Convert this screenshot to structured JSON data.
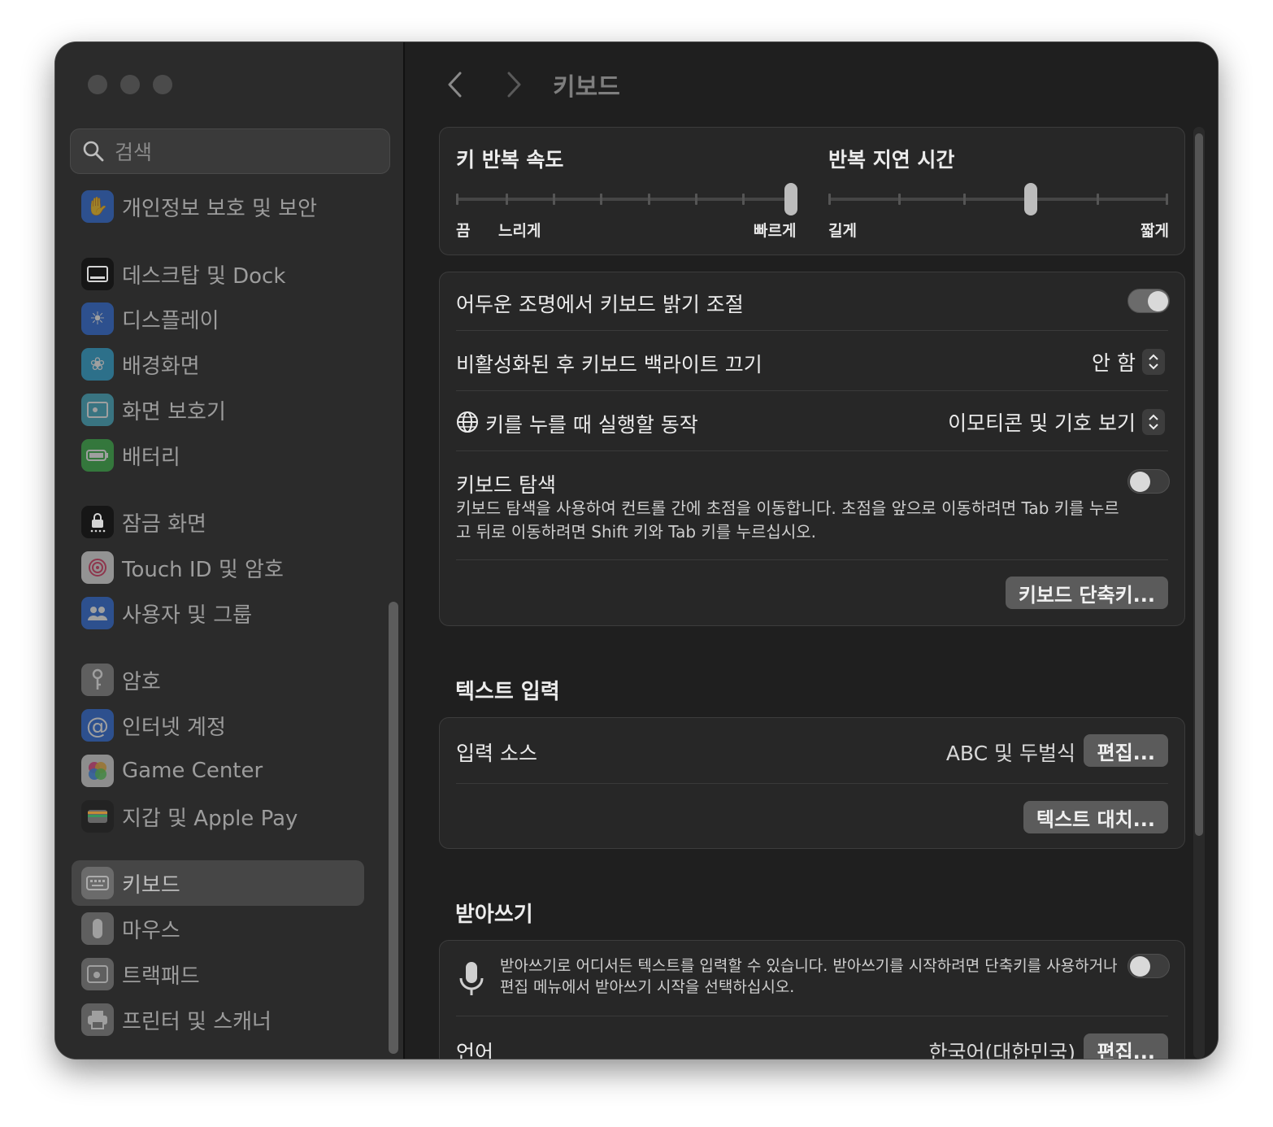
{
  "sidebar": {
    "search_placeholder": "검색",
    "items": [
      {
        "label": "개인정보 보호 및 보안",
        "icon": "hand-icon",
        "color": "#2f6fe0"
      },
      {
        "label": "데스크탑 및 Dock",
        "icon": "dock-icon",
        "color": "#111111"
      },
      {
        "label": "디스플레이",
        "icon": "sun-icon",
        "color": "#2f6fe0"
      },
      {
        "label": "배경화면",
        "icon": "flower-icon",
        "color": "#2fa9d8"
      },
      {
        "label": "화면 보호기",
        "icon": "screensaver-icon",
        "color": "#45b0c8"
      },
      {
        "label": "배터리",
        "icon": "battery-icon",
        "color": "#3cb64a"
      },
      {
        "label": "잠금 화면",
        "icon": "lock-icon",
        "color": "#111111"
      },
      {
        "label": "Touch ID 및 암호",
        "icon": "fingerprint-icon",
        "color": "#e9e9e9"
      },
      {
        "label": "사용자 및 그룹",
        "icon": "users-icon",
        "color": "#2f6fe0"
      },
      {
        "label": "암호",
        "icon": "key-icon",
        "color": "#8a8a8a"
      },
      {
        "label": "인터넷 계정",
        "icon": "at-icon",
        "color": "#2f6fe0"
      },
      {
        "label": "Game Center",
        "icon": "gamecenter-icon",
        "color": "#dddddd"
      },
      {
        "label": "지갑 및 Apple Pay",
        "icon": "wallet-icon",
        "color": "#222222"
      },
      {
        "label": "키보드",
        "icon": "keyboard-icon",
        "color": "#8a8a8a"
      },
      {
        "label": "마우스",
        "icon": "mouse-icon",
        "color": "#8a8a8a"
      },
      {
        "label": "트랙패드",
        "icon": "trackpad-icon",
        "color": "#8a8a8a"
      },
      {
        "label": "프린터 및 스캐너",
        "icon": "printer-icon",
        "color": "#8a8a8a"
      }
    ]
  },
  "header": {
    "title": "키보드"
  },
  "repeat": {
    "key_repeat_title": "키 반복 속도",
    "key_repeat_labels": [
      "끔",
      "느리게",
      "빠르게"
    ],
    "key_repeat_value": 1.0,
    "delay_title": "반복 지연 시간",
    "delay_labels": [
      "길게",
      "짧게"
    ],
    "delay_value": 0.6
  },
  "options": {
    "adjust_brightness": "어두운 조명에서 키보드 밝기 조절",
    "adjust_brightness_on": true,
    "backlight_off": "비활성화된 후 키보드 백라이트 끄기",
    "backlight_off_value": "안 함",
    "globe_key": "키를 누를 때 실행할 동작",
    "globe_key_value": "이모티콘 및 기호 보기",
    "keyboard_nav": "키보드 탐색",
    "keyboard_nav_desc": "키보드 탐색을 사용하여 컨트롤 간에 초점을 이동합니다. 초점을 앞으로 이동하려면 Tab 키를 누르고 뒤로 이동하려면 Shift 키와 Tab 키를 누르십시오.",
    "keyboard_nav_on": false,
    "shortcuts_button": "키보드 단축키..."
  },
  "text_input": {
    "section_title": "텍스트 입력",
    "input_sources": "입력 소스",
    "input_sources_value": "ABC 및 두벌식",
    "edit_button": "편집...",
    "text_replace_button": "텍스트 대치..."
  },
  "dictation": {
    "section_title": "받아쓰기",
    "desc": "받아쓰기로 어디서든 텍스트를 입력할 수 있습니다. 받아쓰기를 시작하려면 단축키를 사용하거나 편집 메뉴에서 받아쓰기 시작을 선택하십시오.",
    "on": false,
    "language": "언어",
    "language_value": "한국어(대한민국)",
    "edit_button": "편집..."
  }
}
